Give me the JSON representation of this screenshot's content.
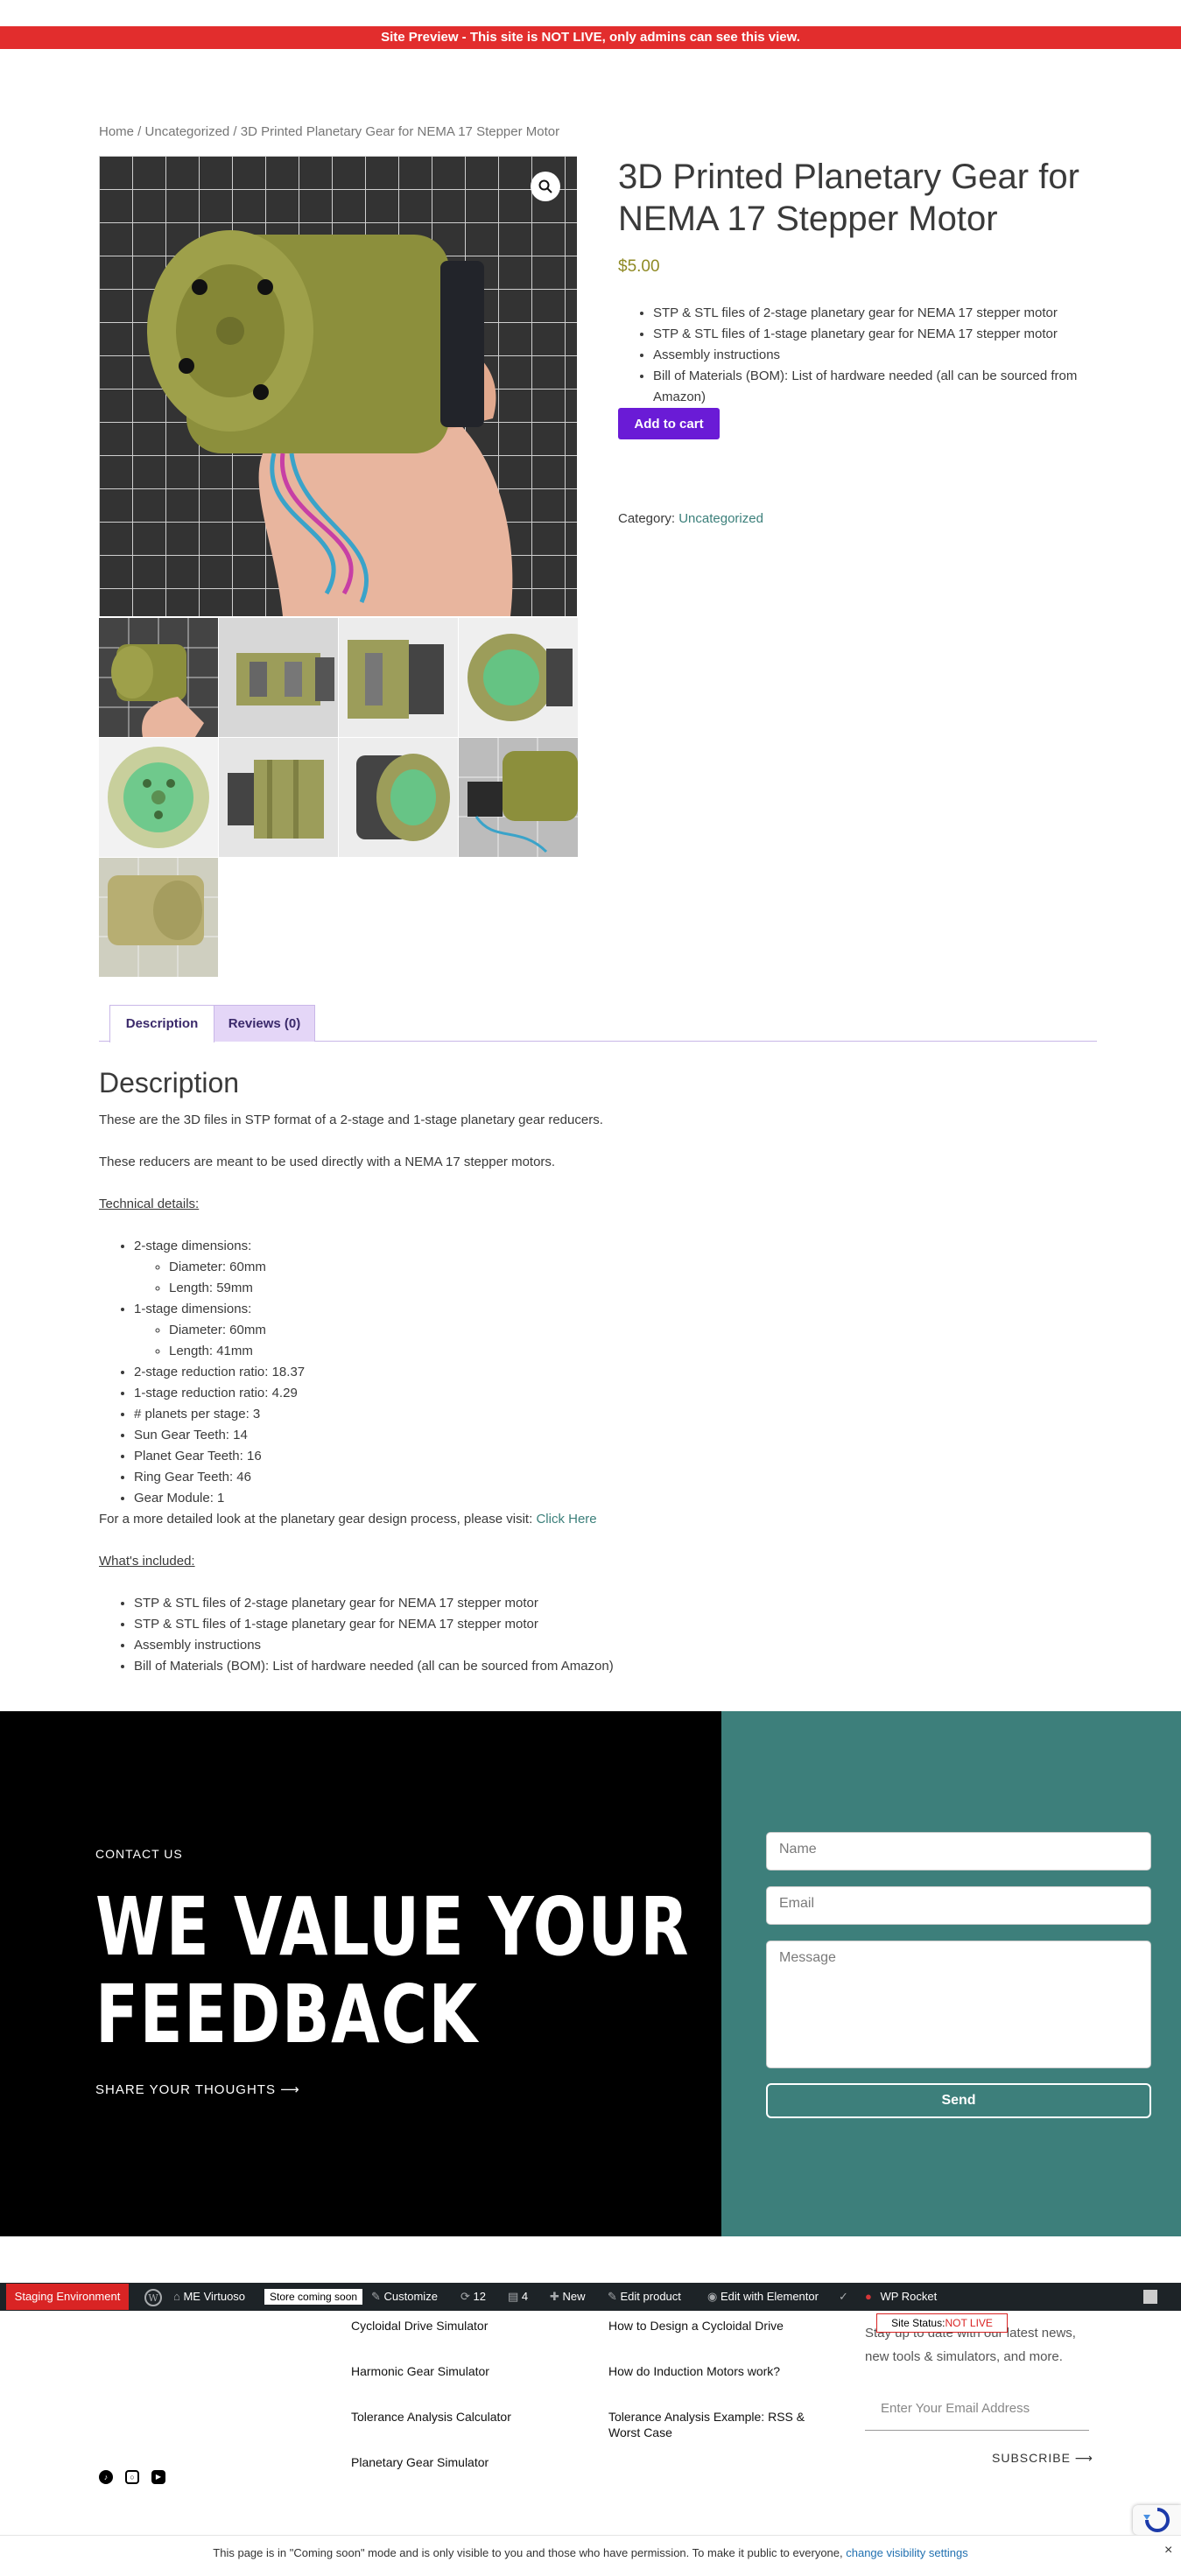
{
  "preview_bar": "Site Preview - This site is NOT LIVE, only admins can see this view.",
  "breadcrumb": {
    "home": "Home",
    "sep1": " / ",
    "cat": "Uncategorized",
    "sep2": " / ",
    "current": "3D Printed Planetary Gear for NEMA 17 Stepper Motor"
  },
  "product": {
    "title": "3D Printed Planetary Gear for NEMA 17 Stepper Motor",
    "price": "$5.00",
    "features": [
      "STP & STL files of 2-stage planetary gear for NEMA 17 stepper motor",
      "STP & STL files of 1-stage planetary gear for NEMA 17 stepper motor",
      "Assembly instructions",
      "Bill of Materials (BOM): List of hardware needed (all can be sourced from Amazon)"
    ],
    "add_to_cart": "Add to cart",
    "category_label": "Category: ",
    "category": "Uncategorized"
  },
  "tabs": [
    "Description",
    "Reviews (0)"
  ],
  "description": {
    "heading": "Description",
    "p1": "These are the 3D files in STP format of a 2-stage and 1-stage planetary gear reducers.",
    "p2": "These reducers are meant to be used directly with a NEMA 17 stepper motors.",
    "tech_heading": "Technical details:",
    "two_stage": "2-stage dimensions:",
    "two_stage_items": [
      "Diameter: 60mm",
      "Length: 59mm"
    ],
    "one_stage": "1-stage dimensions:",
    "one_stage_items": [
      "Diameter: 60mm",
      "Length: 41mm"
    ],
    "specs": [
      "2-stage reduction ratio: 18.37",
      "1-stage reduction ratio: 4.29",
      "# planets per stage: 3",
      "Sun Gear Teeth: 14",
      "Planet Gear Teeth: 16",
      "Ring Gear Teeth: 46",
      "Gear Module: 1"
    ],
    "more_text": "For a more detailed look at the planetary gear design process, please visit: ",
    "more_link": "Click Here",
    "included_heading": "What's included:",
    "included": [
      "STP & STL files of 2-stage planetary gear for NEMA 17 stepper motor",
      "STP & STL files of 1-stage planetary gear for NEMA 17 stepper motor",
      "Assembly instructions",
      "Bill of Materials (BOM): List of hardware needed (all can be sourced from Amazon)"
    ]
  },
  "contact": {
    "label": "CONTACT US",
    "heading_line1": "WE VALUE YOUR",
    "heading_line2": "FEEDBACK",
    "share": "SHARE YOUR THOUGHTS ⟶",
    "name_ph": "Name",
    "email_ph": "Email",
    "message_ph": "Message",
    "send": "Send"
  },
  "adminbar": {
    "staging": "Staging Environment",
    "site": "ME Virtuoso",
    "store_badge": "Store coming soon",
    "customize": "Customize",
    "updates": "12",
    "comments": "4",
    "new": "New",
    "edit_product": "Edit product",
    "elementor": "Edit with Elementor",
    "rocket": "WP Rocket"
  },
  "footer": {
    "col1": [
      "Cycloidal Drive Simulator",
      "Harmonic Gear Simulator",
      "Tolerance Analysis Calculator",
      "Planetary Gear Simulator"
    ],
    "col2": [
      "How to Design a Cycloidal Drive",
      "How do Induction Motors work?",
      "Tolerance Analysis Example: RSS & Worst Case"
    ],
    "site_status_label": "Site Status:",
    "site_status_value": "NOT LIVE",
    "subscribe_text": "Stay up to date with our latest news, new tools & simulators, and more.",
    "email_ph": "Enter Your Email Address",
    "subscribe": "SUBSCRIBE ⟶"
  },
  "notice": {
    "text": "This page is in \"Coming soon\" mode and is only visible to you and those who have permission. To make it public to everyone, ",
    "link": "change visibility settings",
    "close": "×"
  },
  "colors": {
    "accent": "#6a1bd6",
    "teal": "#3d7f7b",
    "preview_red": "#e22d2d",
    "price": "#8f8a24"
  }
}
